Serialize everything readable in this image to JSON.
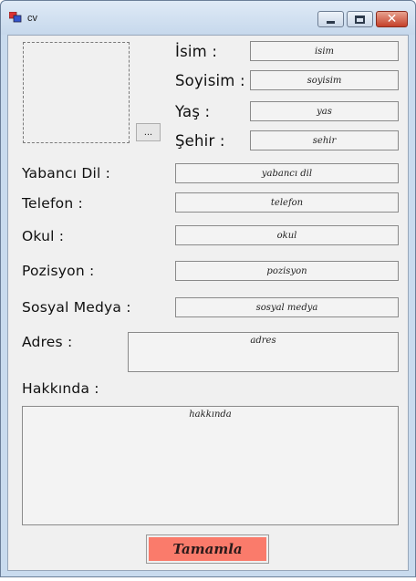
{
  "window": {
    "title": "cv",
    "accent": "#c9dbee",
    "controls": {
      "minimize": "minimize-icon",
      "maximize": "maximize-icon",
      "close": "close-icon"
    }
  },
  "photo": {
    "browse_label": "..."
  },
  "fields": {
    "isim": {
      "label": "İsim :",
      "value": "isim"
    },
    "soyisim": {
      "label": "Soyisim :",
      "value": "soyisim"
    },
    "yas": {
      "label": "Yaş :",
      "value": "yas"
    },
    "sehir": {
      "label": "Şehir :",
      "value": "sehir"
    },
    "yabanci_dil": {
      "label": "Yabancı Dil :",
      "value": "yabancı dil"
    },
    "telefon": {
      "label": "Telefon :",
      "value": "telefon"
    },
    "okul": {
      "label": "Okul :",
      "value": "okul"
    },
    "pozisyon": {
      "label": "Pozisyon :",
      "value": "pozisyon"
    },
    "sosyal_medya": {
      "label": "Sosyal Medya :",
      "value": "sosyal medya"
    },
    "adres": {
      "label": "Adres :",
      "value": "adres"
    },
    "hakkinda": {
      "label": "Hakkında :",
      "value": "hakkında"
    }
  },
  "submit": {
    "label": "Tamamla",
    "color": "#fa7b6b"
  }
}
